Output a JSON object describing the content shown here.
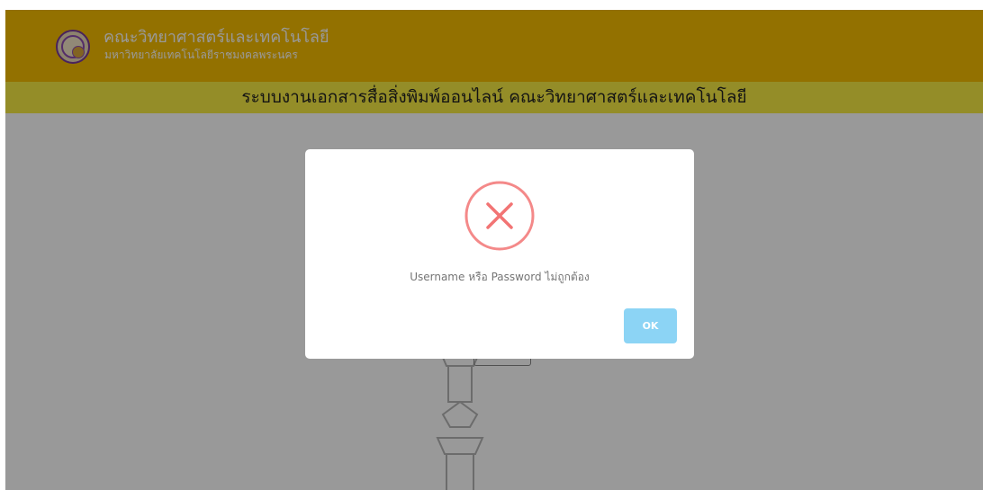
{
  "header": {
    "faculty_name": "คณะวิทยาศาสตร์และเทคโนโลยี",
    "university_name": "มหาวิทยาลัยเทคโนโลยีราชมงคลพระนคร",
    "logo_icon": "university-seal-icon",
    "background_color": "#f5bd00"
  },
  "title_bar": {
    "title": "ระบบงานเอกสารสื่อสิ่งพิมพ์ออนไลน์ คณะวิทยาศาสตร์และเทคโนโลยี",
    "background_color": "#f7ec43"
  },
  "dialog": {
    "icon": "error-x-icon",
    "icon_color": "#f27474",
    "message": "Username หรือ Password ไม่ถูกต้อง",
    "ok_label": "OK",
    "ok_color": "#8cd4f5"
  }
}
